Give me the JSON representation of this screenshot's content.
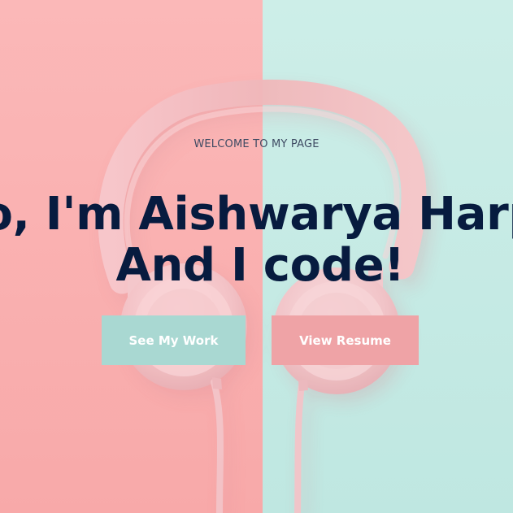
{
  "hero": {
    "eyebrow": "WELCOME TO MY PAGE",
    "headline_line1": "Hello, I'm Aishwarya Harpale!",
    "headline_line2": "And I code!",
    "buttons": {
      "work": "See My Work",
      "resume": "View Resume"
    },
    "colors": {
      "left_background": "#fbb8b8",
      "right_background": "#cdeee8",
      "headline": "#071b3f",
      "button_work": "#a9d8d2",
      "button_resume": "#efa3a6"
    }
  }
}
